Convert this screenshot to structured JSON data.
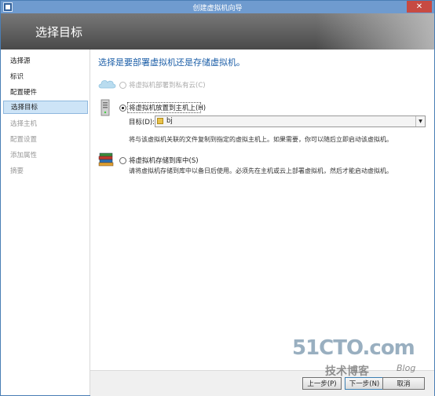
{
  "window": {
    "title": "创建虚拟机向导",
    "close_glyph": "✕"
  },
  "header": {
    "page_title": "选择目标"
  },
  "sidebar": {
    "items": [
      {
        "label": "选择源",
        "state": "done"
      },
      {
        "label": "标识",
        "state": "done"
      },
      {
        "label": "配置硬件",
        "state": "done"
      },
      {
        "label": "选择目标",
        "state": "active"
      },
      {
        "label": "选择主机",
        "state": "pending"
      },
      {
        "label": "配置设置",
        "state": "pending"
      },
      {
        "label": "添加属性",
        "state": "pending"
      },
      {
        "label": "摘要",
        "state": "pending"
      }
    ]
  },
  "content": {
    "question": "选择是要部署虚拟机还是存储虚拟机。",
    "options": {
      "cloud": {
        "label": "将虚拟机部署到私有云(C)",
        "enabled": false,
        "selected": false,
        "icon": "cloud-icon"
      },
      "host": {
        "label": "将虚拟机放置到主机上(H)",
        "enabled": true,
        "selected": true,
        "icon": "server-icon",
        "destination_label": "目标(D):",
        "destination_value": "bj",
        "description": "将与该虚拟机关联的文件复制到指定的虚拟主机上。如果需要，你可以随后立即启动该虚拟机。"
      },
      "library": {
        "label": "将虚拟机存储到库中(S)",
        "enabled": true,
        "selected": false,
        "icon": "library-books-icon",
        "description": "请将虚拟机存储到库中以备日后使用。必须先在主机或云上部署虚拟机，然后才能启动虚拟机。"
      }
    }
  },
  "footer": {
    "prev": "上一步(P)",
    "next": "下一步(N)",
    "cancel": "取消"
  },
  "watermark": {
    "site": "51CTO.com",
    "tagline": "技术博客",
    "blog": "Blog"
  },
  "colors": {
    "accent": "#1d5fa8",
    "titlebar": "#6f9bcf",
    "close": "#c74a42",
    "selection": "#cde4f7"
  }
}
